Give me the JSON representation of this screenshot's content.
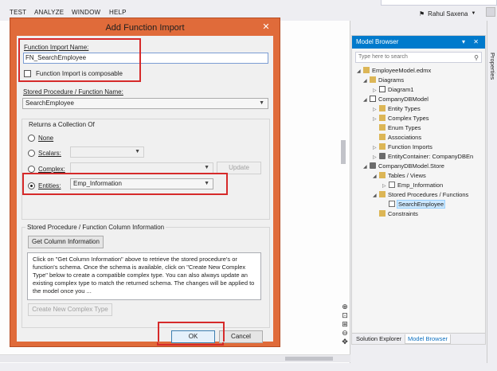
{
  "menubar": {
    "items": [
      "TEST",
      "ANALYZE",
      "WINDOW",
      "HELP"
    ],
    "user_name": "Rahul Saxena"
  },
  "dialog": {
    "title": "Add Function Import",
    "close_glyph": "✕",
    "function_import_name_label": "Function Import Name:",
    "function_import_name_value": "FN_SearchEmployee",
    "composable_label": "Function Import is composable",
    "composable_checked": false,
    "stored_procedure_label": "Stored Procedure / Function Name:",
    "stored_procedure_value": "SearchEmployee",
    "returns_label": "Returns a Collection Of",
    "return_options": {
      "none": "None",
      "scalars": "Scalars:",
      "complex": "Complex:",
      "entities": "Entities:"
    },
    "selected_return": "entities",
    "entities_value": "Emp_Information",
    "update_button": "Update",
    "column_info_label": "Stored Procedure / Function Column Information",
    "get_column_info_button": "Get Column Information",
    "info_text": "Click on \"Get Column Information\" above to retrieve the stored procedure's or function's schema. Once the schema is available, click on \"Create New Complex Type\" below to create a compatible complex type. You can also always update an existing complex type to match the returned schema. The changes will be applied to the model once you ...",
    "create_complex_type_button": "Create New Complex Type",
    "ok_button": "OK",
    "cancel_button": "Cancel"
  },
  "model_browser": {
    "title": "Model Browser",
    "title_buttons": "▾ ✕",
    "search_placeholder": "Type here to search",
    "tree": [
      {
        "label": "EmployeeModel.edmx",
        "expanded": true
      },
      {
        "label": "Diagrams",
        "expanded": true
      },
      {
        "label": "Diagram1",
        "expanded": false
      },
      {
        "label": "CompanyDBModel",
        "expanded": true
      },
      {
        "label": "Entity Types",
        "expanded": false
      },
      {
        "label": "Complex Types",
        "expanded": false
      },
      {
        "label": "Enum Types",
        "expanded": null
      },
      {
        "label": "Associations",
        "expanded": null
      },
      {
        "label": "Function Imports",
        "expanded": false
      },
      {
        "label": "EntityContainer: CompanyDBEn",
        "expanded": false
      },
      {
        "label": "CompanyDBModel.Store",
        "expanded": true
      },
      {
        "label": "Tables / Views",
        "expanded": true
      },
      {
        "label": "Emp_Information",
        "expanded": false
      },
      {
        "label": "Stored Procedures / Functions",
        "expanded": true
      },
      {
        "label": "SearchEmployee",
        "expanded": null,
        "selected": true
      },
      {
        "label": "Constraints",
        "expanded": null
      }
    ],
    "tabs": [
      "Solution Explorer",
      "Model Browser"
    ],
    "active_tab": "Model Browser"
  },
  "properties_rail": {
    "label": "Properties"
  },
  "colors": {
    "accent_blue": "#007acc",
    "dialog_chrome": "#e06b3a",
    "highlight_red": "#d62a2a"
  }
}
